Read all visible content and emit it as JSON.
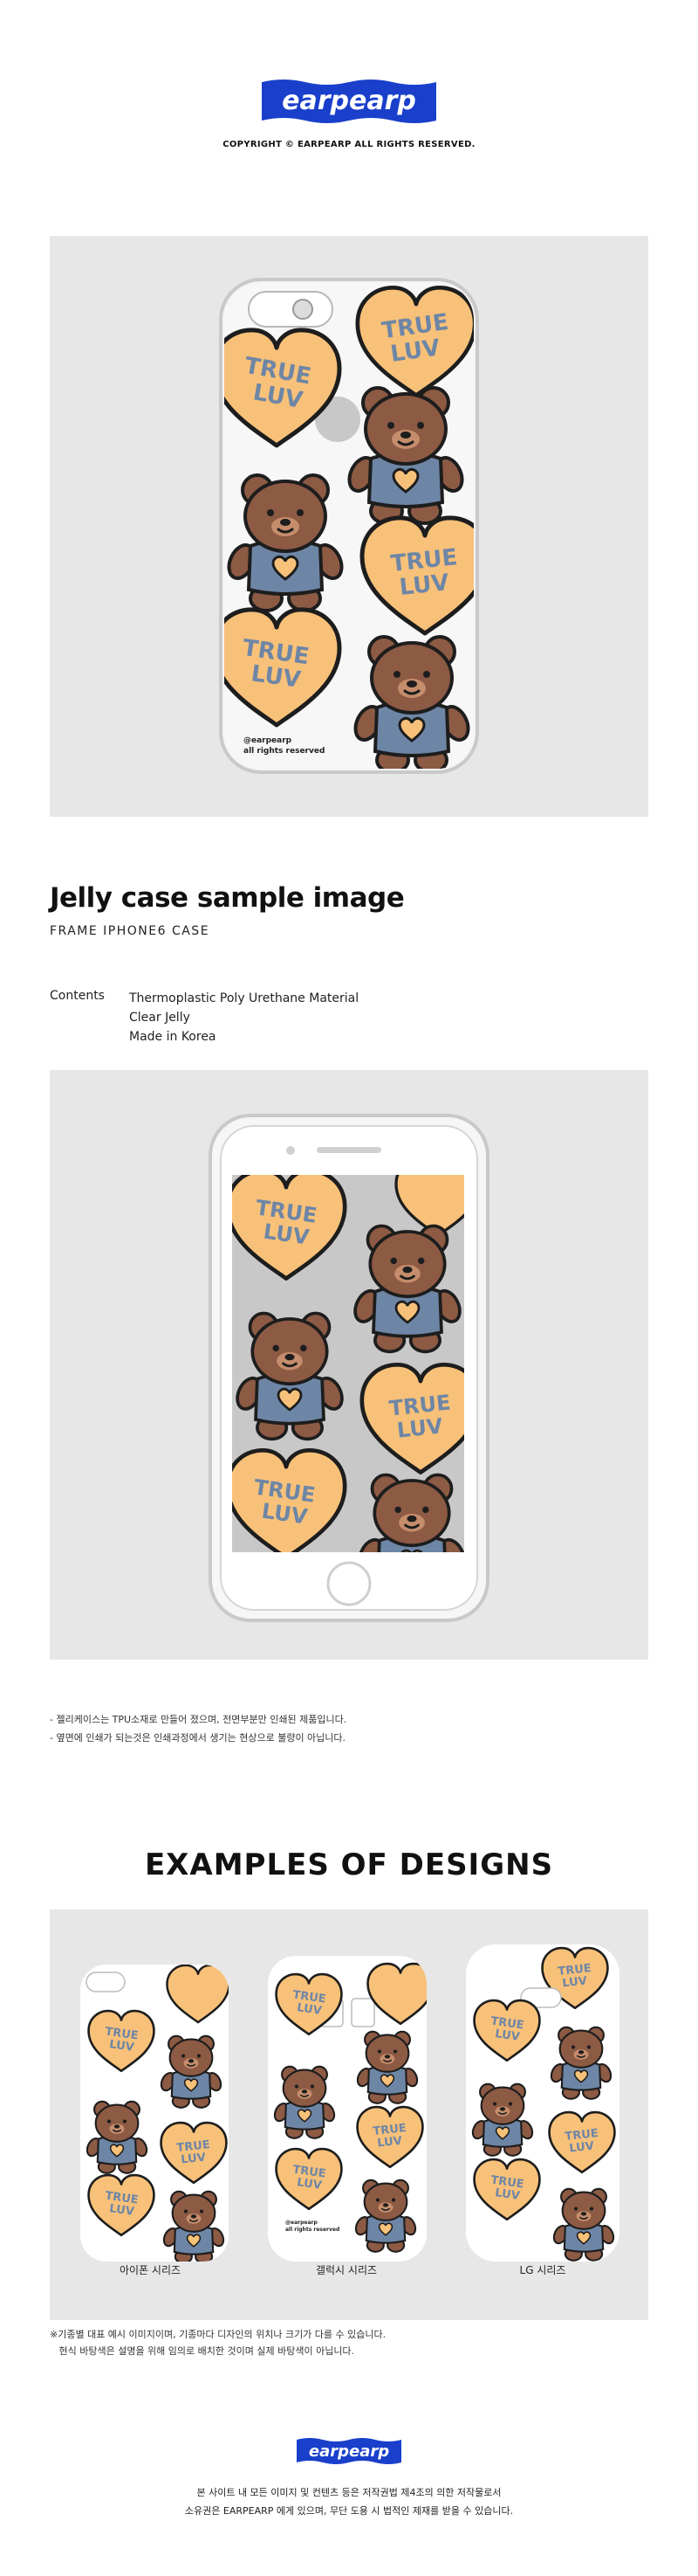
{
  "brand": {
    "logo_text": "earpearp",
    "copyright": "COPYRIGHT © EARPEARP ALL RIGHTS RESERVED.",
    "color": "#1a3fcb"
  },
  "case_print": {
    "heart_text_line1": "TRUE",
    "heart_text_line2": "LUV",
    "watermark_line1": "@earpearp",
    "watermark_line2": "all rights reserved",
    "heart_color": "#f8c179",
    "bear_color": "#8d5a44",
    "shirt_color": "#6e86a6"
  },
  "product": {
    "title": "Jelly case sample image",
    "subtitle": "FRAME IPHONE6 CASE",
    "contents_label": "Contents",
    "contents": [
      "Thermoplastic Poly Urethane Material",
      "Clear Jelly",
      "Made in Korea"
    ]
  },
  "notes": [
    "- 젤리케이스는 TPU소재로 만들어 졌으며, 전면부분만 인쇄된 제품입니다.",
    "- 옆면에 인쇄가 되는것은 인쇄과정에서 생기는 현상으로 불량이 아닙니다."
  ],
  "examples": {
    "title": "EXAMPLES OF DESIGNS",
    "items": [
      {
        "label": "아이폰 시리즈"
      },
      {
        "label": "갤럭시 시리즈"
      },
      {
        "label": "LG 시리즈"
      }
    ]
  },
  "disclaimer": [
    "※기종별 대표 예시 이미지이며, 기종마다 디자인의 위치나 크기가 다를 수 있습니다.",
    "   현식 바탕색은 설명을 위해 임의로 배치한 것이며 실제 바탕색이 아닙니다."
  ],
  "footer": {
    "logo_text": "earpearp",
    "lines": [
      "본 사이트 내 모든 이미지 및 컨텐츠 등은 저작권법 제4조의 의한 저작물로서",
      "소유권은 EARPEARP 에게 있으며, 무단 도용 시 법적인 제재를 받을 수 있습니다."
    ]
  }
}
